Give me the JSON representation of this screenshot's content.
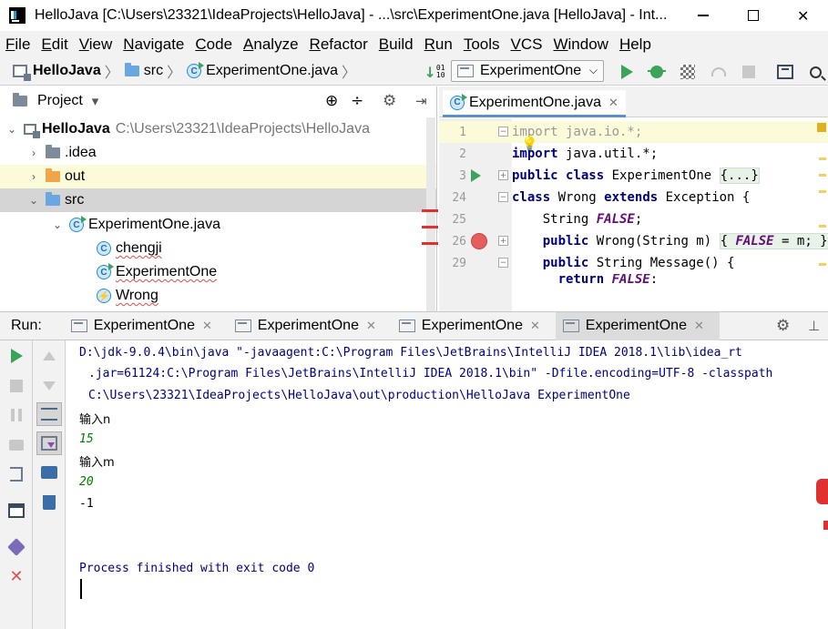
{
  "window": {
    "title": "HelloJava [C:\\Users\\23321\\IdeaProjects\\HelloJava] - ...\\src\\ExperimentOne.java [HelloJava] - Int...",
    "minimize": "—",
    "close": "✕"
  },
  "menu": [
    "File",
    "Edit",
    "View",
    "Navigate",
    "Code",
    "Analyze",
    "Refactor",
    "Build",
    "Run",
    "Tools",
    "VCS",
    "Window",
    "Help"
  ],
  "breadcrumb": {
    "project": "HelloJava",
    "folder": "src",
    "file": "ExperimentOne.java",
    "sep": "〉"
  },
  "run_config": {
    "selected": "ExperimentOne",
    "chevron": "⌵"
  },
  "project_panel": {
    "title": "Project",
    "dropdown": "▾",
    "tree": [
      {
        "arrow": "⌄",
        "label": "HelloJava",
        "path": "C:\\Users\\23321\\IdeaProjects\\HelloJava"
      },
      {
        "arrow": "›",
        "label": ".idea"
      },
      {
        "arrow": "›",
        "label": "out"
      },
      {
        "arrow": "⌄",
        "label": "src"
      },
      {
        "arrow": "⌄",
        "label": "ExperimentOne.java"
      },
      {
        "label": "chengji"
      },
      {
        "label": "ExperimentOne"
      },
      {
        "label": "Wrong"
      }
    ]
  },
  "editor": {
    "tab_label": "ExperimentOne.java",
    "tab_close": "✕",
    "lines": [
      {
        "num": "1"
      },
      {
        "num": "2"
      },
      {
        "num": "3"
      },
      {
        "num": "24"
      },
      {
        "num": "25"
      },
      {
        "num": "26"
      },
      {
        "num": "29"
      }
    ],
    "code": {
      "l1_kw": "import",
      "l1_rest": " java.io.*;",
      "l2_kw": "import",
      "l2_rest": " java.util.*;",
      "l3_kw1": "public",
      "l3_kw2": "class",
      "l3_name": " ExperimentOne ",
      "l3_fold": "{...}",
      "l24_kw1": "class",
      "l24_name": " Wrong ",
      "l24_kw2": "extends",
      "l24_rest": " Exception {",
      "l25_type": "    String ",
      "l25_const": "FALSE",
      "l25_end": ";",
      "l26_kw": "public",
      "l26_sig": " Wrong(String m) ",
      "l26_body_a": "{ ",
      "l26_const": "FALSE",
      "l26_body_b": " = m; }",
      "l29_kw": "public",
      "l29_rest": " String Message() {",
      "l30_kw": "return",
      "l30_const": "FALSE",
      "l30_end": ";"
    }
  },
  "run": {
    "label": "Run:",
    "tabs": [
      "ExperimentOne",
      "ExperimentOne",
      "ExperimentOne",
      "ExperimentOne"
    ],
    "tab_close": "✕",
    "active_tab": 3
  },
  "console": {
    "cmd1": "D:\\jdk-9.0.4\\bin\\java \"-javaagent:C:\\Program Files\\JetBrains\\IntelliJ IDEA 2018.1\\lib\\idea_rt",
    "cmd2": ".jar=61124:C:\\Program Files\\JetBrains\\IntelliJ IDEA 2018.1\\bin\" -Dfile.encoding=UTF-8 -classpath",
    "cmd3": "C:\\Users\\23321\\IdeaProjects\\HelloJava\\out\\production\\HelloJava ExperimentOne",
    "prompt_n": "输入n",
    "input_n": "15",
    "prompt_m": "输入m",
    "input_m": "20",
    "result": "-1",
    "finished": "Process finished with exit code 0"
  },
  "icons": {
    "settings": "⚙",
    "minimize_panel": "⊥",
    "crosshair": "⊕",
    "collapse": "÷",
    "exit_pin": "⇥"
  },
  "colors": {
    "keyword": "#000080",
    "constant": "#660e7a",
    "run_green": "#3aa55a",
    "breakpoint_red": "#e55d5d",
    "highlight": "#fcfbd9"
  }
}
